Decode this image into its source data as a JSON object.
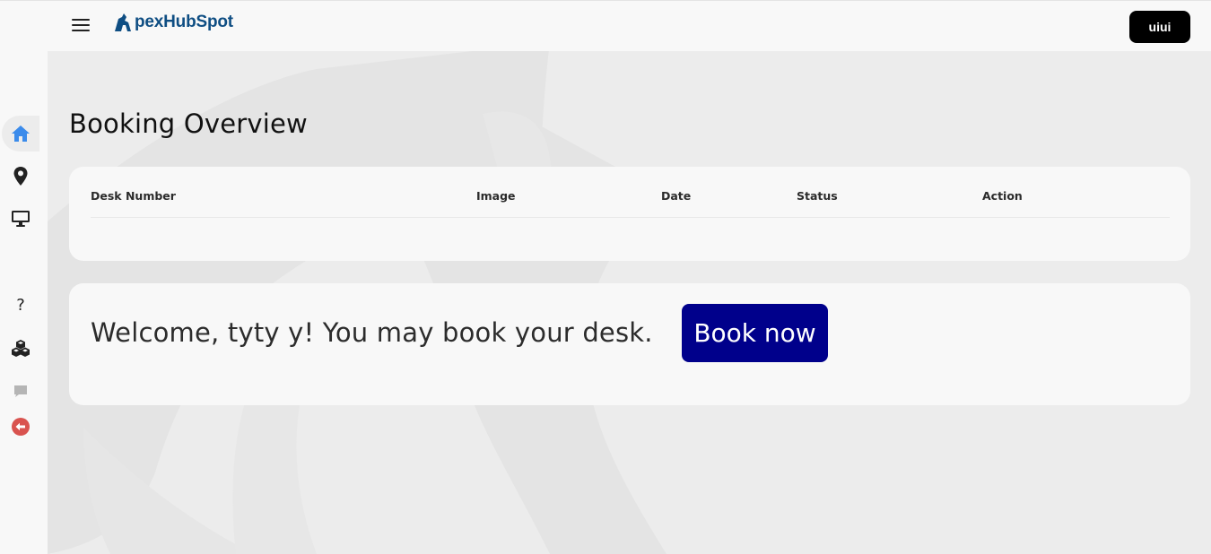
{
  "header": {
    "logo_text": "pexHubSpot",
    "logo_color": "#0f4e83",
    "user_button_label": "uiui"
  },
  "sidebar": {
    "items": [
      {
        "icon": "home-icon",
        "active": true,
        "color": "#3b8beb"
      },
      {
        "icon": "location-pin-icon",
        "active": false
      },
      {
        "icon": "monitor-icon",
        "active": false
      },
      {
        "icon": "help-icon",
        "glyph": "?",
        "active": false
      },
      {
        "icon": "cubes-icon",
        "active": false
      },
      {
        "icon": "chat-icon",
        "active": false
      },
      {
        "icon": "logout-icon",
        "active": false,
        "color": "#d9534f"
      }
    ]
  },
  "main": {
    "title": "Booking Overview",
    "table": {
      "columns": [
        "Desk Number",
        "Image",
        "Date",
        "Status",
        "Action"
      ],
      "rows": []
    },
    "welcome": {
      "message": "Welcome, tyty y! You may book your desk.",
      "book_button_label": "Book now",
      "book_button_color": "#00008b"
    }
  }
}
